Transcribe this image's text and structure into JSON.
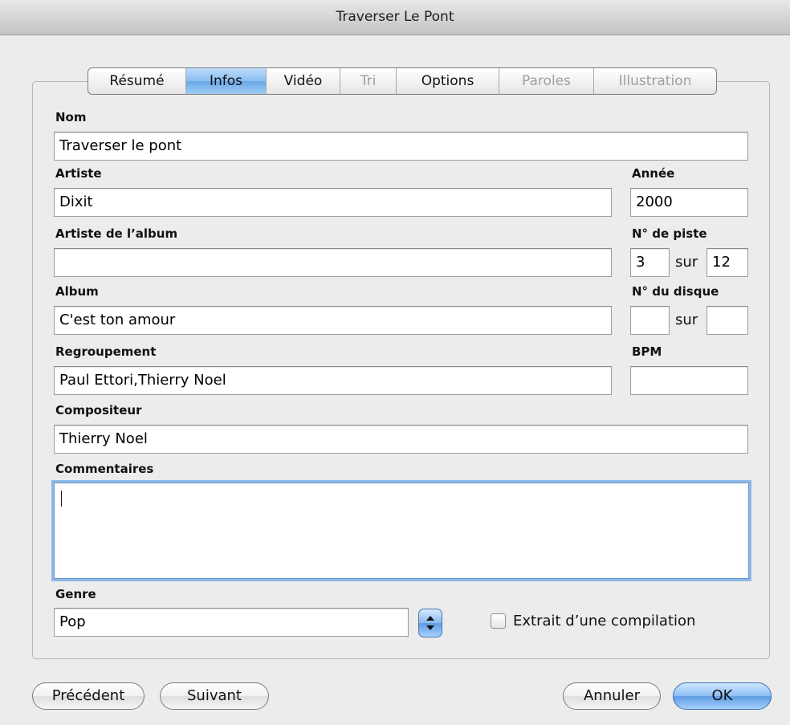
{
  "window": {
    "title": "Traverser Le Pont"
  },
  "tabs": [
    {
      "label": "Résumé",
      "state": "normal"
    },
    {
      "label": "Infos",
      "state": "active"
    },
    {
      "label": "Vidéo",
      "state": "normal"
    },
    {
      "label": "Tri",
      "state": "disabled"
    },
    {
      "label": "Options",
      "state": "normal"
    },
    {
      "label": "Paroles",
      "state": "disabled"
    },
    {
      "label": "Illustration",
      "state": "disabled"
    }
  ],
  "fields": {
    "name": {
      "label": "Nom",
      "value": "Traverser le pont"
    },
    "artist": {
      "label": "Artiste",
      "value": "Dixit"
    },
    "year": {
      "label": "Année",
      "value": "2000"
    },
    "album_artist": {
      "label": "Artiste de l’album",
      "value": ""
    },
    "track": {
      "label": "N° de piste",
      "number": "3",
      "of_label": "sur",
      "total": "12"
    },
    "album": {
      "label": "Album",
      "value": "C'est ton amour"
    },
    "disc": {
      "label": "N° du disque",
      "number": "",
      "of_label": "sur",
      "total": ""
    },
    "grouping": {
      "label": "Regroupement",
      "value": "Paul Ettori,Thierry Noel"
    },
    "bpm": {
      "label": "BPM",
      "value": ""
    },
    "composer": {
      "label": "Compositeur",
      "value": "Thierry Noel"
    },
    "comments": {
      "label": "Commentaires",
      "value": ""
    },
    "genre": {
      "label": "Genre",
      "value": "Pop"
    }
  },
  "compilation": {
    "label": "Extrait d’une compilation",
    "checked": false
  },
  "buttons": {
    "previous": "Précédent",
    "next": "Suivant",
    "cancel": "Annuler",
    "ok": "OK"
  },
  "colors": {
    "accent": "#6aa8e6",
    "focus_ring": "#8db8e8"
  }
}
